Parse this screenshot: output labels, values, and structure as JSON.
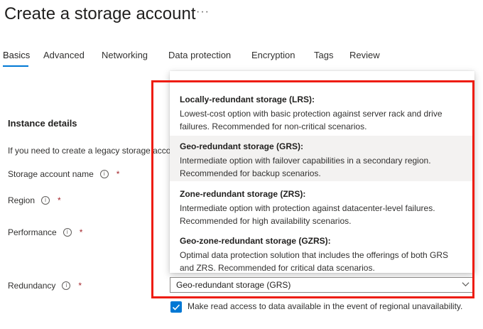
{
  "page": {
    "title": "Create a storage account",
    "more_label": "···"
  },
  "tabs": [
    {
      "label": "Basics",
      "active": true
    },
    {
      "label": "Advanced"
    },
    {
      "label": "Networking"
    },
    {
      "label": "Data protection"
    },
    {
      "label": "Encryption"
    },
    {
      "label": "Tags"
    },
    {
      "label": "Review"
    }
  ],
  "instance": {
    "section_title": "Instance details",
    "legacy_text": "If you need to create a legacy storage account",
    "fields": [
      {
        "label": "Storage account name",
        "info": "i",
        "required": "*"
      },
      {
        "label": "Region",
        "info": "i",
        "required": "*"
      },
      {
        "label": "Performance",
        "info": "i",
        "required": "*"
      },
      {
        "label": "Redundancy",
        "info": "i",
        "required": "*"
      }
    ]
  },
  "redundancy_dropdown": {
    "options": [
      {
        "title": "Locally-redundant storage (LRS):",
        "desc": "Lowest-cost option with basic protection against server rack and drive failures. Recommended for non-critical scenarios."
      },
      {
        "title": "Geo-redundant storage (GRS):",
        "desc": "Intermediate option with failover capabilities in a secondary region. Recommended for backup scenarios.",
        "selected": true
      },
      {
        "title": "Zone-redundant storage (ZRS):",
        "desc": "Intermediate option with protection against datacenter-level failures. Recommended for high availability scenarios."
      },
      {
        "title": "Geo-zone-redundant storage (GZRS):",
        "desc": "Optimal data protection solution that includes the offerings of both GRS and ZRS. Recommended for critical data scenarios."
      }
    ],
    "selected_value": "Geo-redundant storage (GRS)"
  },
  "read_access": {
    "checked": true,
    "label": "Make read access to data available in the event of regional unavailability."
  },
  "colors": {
    "accent": "#0078d4",
    "highlight_border": "#ee1c0f",
    "selected_option_bg": "#f3f2f1",
    "required": "#a4262c"
  },
  "icons": {
    "more": "more-icon",
    "info": "info-icon",
    "chevron": "chevron-down-icon",
    "checkbox": "checkmark-icon"
  }
}
